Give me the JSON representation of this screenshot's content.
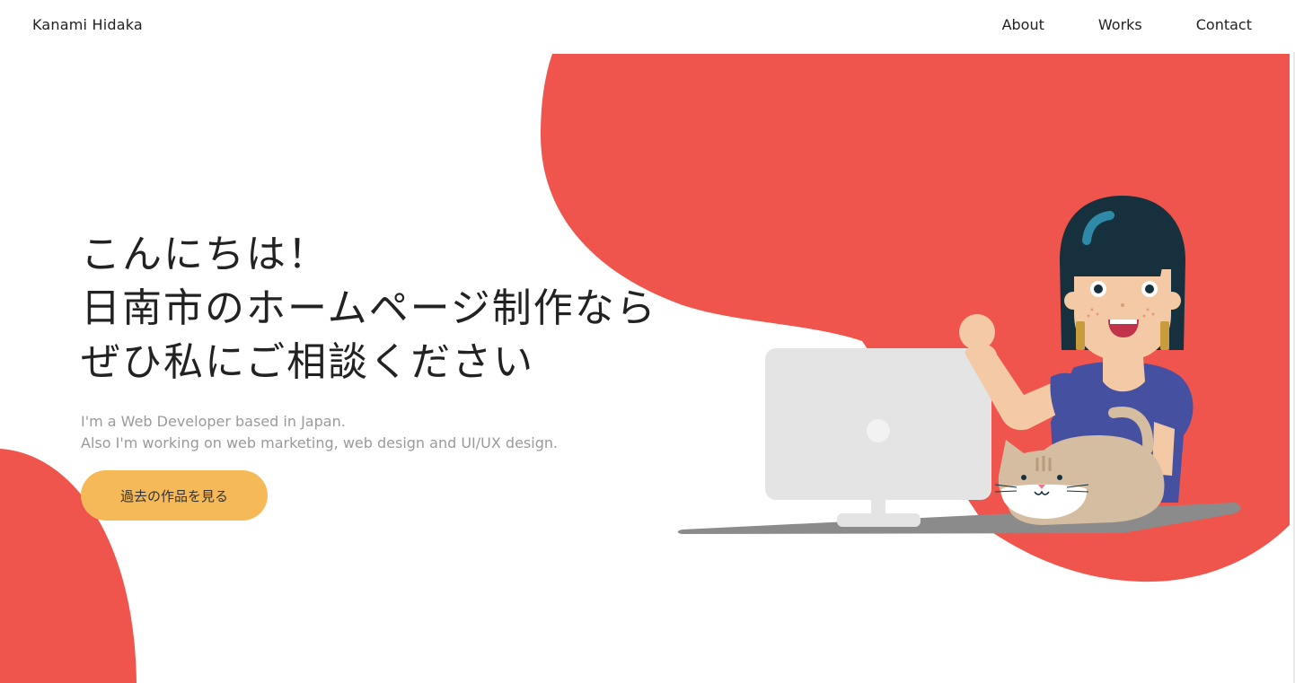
{
  "header": {
    "site_name": "Kanami Hidaka",
    "nav": {
      "about": "About",
      "works": "Works",
      "contact": "Contact"
    }
  },
  "hero": {
    "title_lines": [
      "こんにちは！",
      "日南市のホームページ制作なら",
      "ぜひ私にご相談ください"
    ],
    "subtitle_lines": [
      "I'm a Web Developer based in Japan.",
      "Also I'm working on web marketing, web design and UI/UX design."
    ],
    "cta_label": "過去の作品を見る"
  },
  "colors": {
    "accent_red": "#ef554d",
    "cta_yellow": "#f6b957",
    "text_dark": "#222222",
    "text_muted": "#9a9a9a"
  },
  "icons": {
    "illustration": "woman-with-computer-and-cat-illustration"
  }
}
